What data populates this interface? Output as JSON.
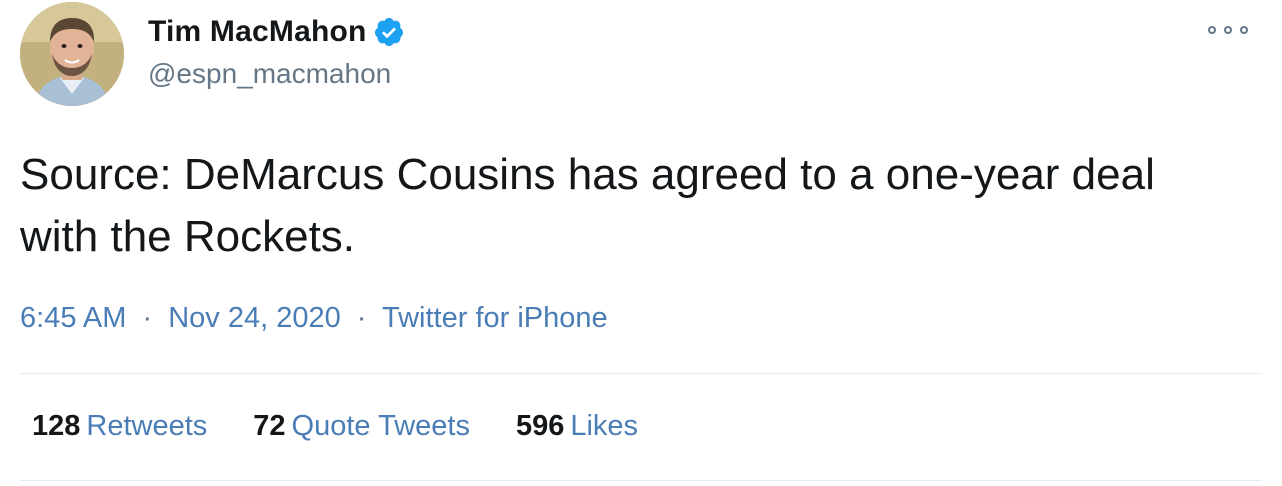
{
  "author": {
    "display_name": "Tim MacMahon",
    "handle": "@espn_macmahon",
    "verified": true,
    "avatar_icon": "profile-photo"
  },
  "tweet": {
    "text": "Source: DeMarcus Cousins has agreed to a one-year deal with the Rockets.",
    "time": "6:45 AM",
    "date": "Nov 24, 2020",
    "source": "Twitter for iPhone",
    "separator": "·"
  },
  "stats": {
    "retweets": {
      "count": "128",
      "label": "Retweets"
    },
    "quotes": {
      "count": "72",
      "label": "Quote Tweets"
    },
    "likes": {
      "count": "596",
      "label": "Likes"
    }
  },
  "icons": {
    "more": "more-options-icon",
    "verified": "verified-badge-icon"
  },
  "colors": {
    "verified_blue": "#1da1f2",
    "link_blue": "#4a7db5",
    "muted_gray": "#657786",
    "text": "#14171a"
  }
}
